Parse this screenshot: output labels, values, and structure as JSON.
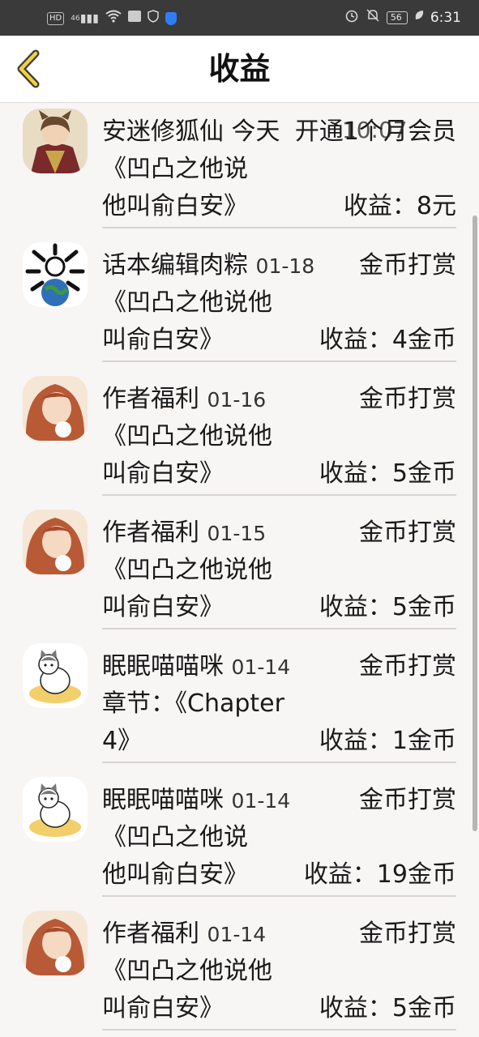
{
  "status_bar": {
    "left_labels": [
      "HD",
      "46"
    ],
    "battery": "56",
    "time": "6:31"
  },
  "header": {
    "title": "收益"
  },
  "entries": [
    {
      "name": "安迷修狐仙",
      "date": "今天",
      "type": "开通1个月会员",
      "type_overlay": "10:07",
      "work_line1": "《凹凸之他说",
      "work_line2": "他叫俞白安》",
      "earnings": "收益：8元"
    },
    {
      "name": "话本编辑肉粽",
      "date": "01-18",
      "type": "金币打赏",
      "work_line1": "《凹凸之他说他",
      "work_line2": "叫俞白安》",
      "earnings": "收益：4金币"
    },
    {
      "name": "作者福利",
      "date": "01-16",
      "type": "金币打赏",
      "work_line1": "《凹凸之他说他",
      "work_line2": "叫俞白安》",
      "earnings": "收益：5金币"
    },
    {
      "name": "作者福利",
      "date": "01-15",
      "type": "金币打赏",
      "work_line1": "《凹凸之他说他",
      "work_line2": "叫俞白安》",
      "earnings": "收益：5金币"
    },
    {
      "name": "眠眠喵喵咪",
      "date": "01-14",
      "type": "金币打赏",
      "work_line1": "章节：《Chapter",
      "work_line2": "4》",
      "earnings": "收益：1金币"
    },
    {
      "name": "眠眠喵喵咪",
      "date": "01-14",
      "type": "金币打赏",
      "work_line1": "《凹凸之他说",
      "work_line2": "他叫俞白安》",
      "earnings": "收益：19金币"
    },
    {
      "name": "作者福利",
      "date": "01-14",
      "type": "金币打赏",
      "work_line1": "《凹凸之他说他",
      "work_line2": "叫俞白安》",
      "earnings": "收益：5金币"
    }
  ]
}
